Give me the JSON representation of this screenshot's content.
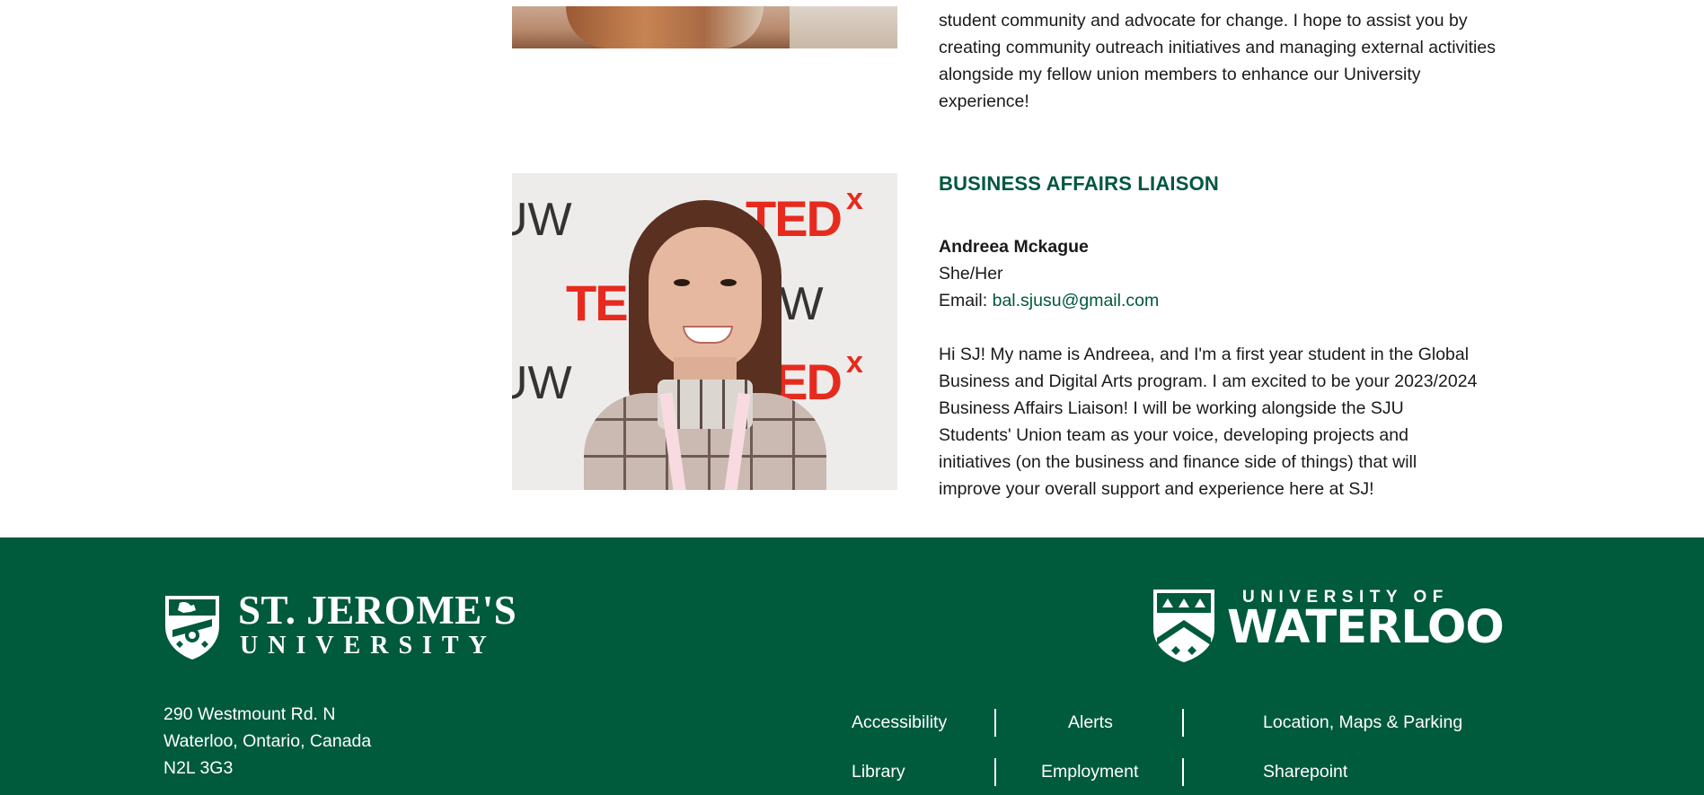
{
  "profile_previous": {
    "bio": "student community and advocate for change. I hope to assist you by creating community outreach initiatives and managing external activities alongside my fellow union members to enhance our University experience!"
  },
  "profile_business": {
    "role": "BUSINESS AFFAIRS LIAISON",
    "name": "Andreea Mckague",
    "pronouns": "She/Her",
    "email_label": "Email: ",
    "email": "bal.sjusu@gmail.com",
    "bio": "Hi SJ! My name is Andreea, and I'm a first year student in the Global Business and Digital Arts program. I am excited to be your 2023/2024 Business Affairs Liaison! I will be working alongside the SJU Students' Union team as your voice, developing projects and initiatives (on the business and finance side of things) that will improve your overall support and experience here at SJ!",
    "photo_text": {
      "tedx": "TED",
      "tedx_x": "x",
      "uw": "UW"
    }
  },
  "footer": {
    "sju_logo": {
      "name": "ST. JEROME'S",
      "sub": "UNIVERSITY"
    },
    "uw_logo": {
      "top": "UNIVERSITY OF",
      "main": "WATERLOO"
    },
    "address": {
      "line1": "290 Westmount Rd. N",
      "line2": "Waterloo, Ontario, Canada",
      "line3": "N2L 3G3"
    },
    "links": {
      "accessibility": "Accessibility",
      "alerts": "Alerts",
      "location": "Location, Maps & Parking",
      "library": "Library",
      "employment": "Employment",
      "sharepoint": "Sharepoint"
    }
  },
  "colors": {
    "brand_green": "#005a3c",
    "heading_green": "#00573f",
    "tedx_red": "#e62b1e"
  }
}
